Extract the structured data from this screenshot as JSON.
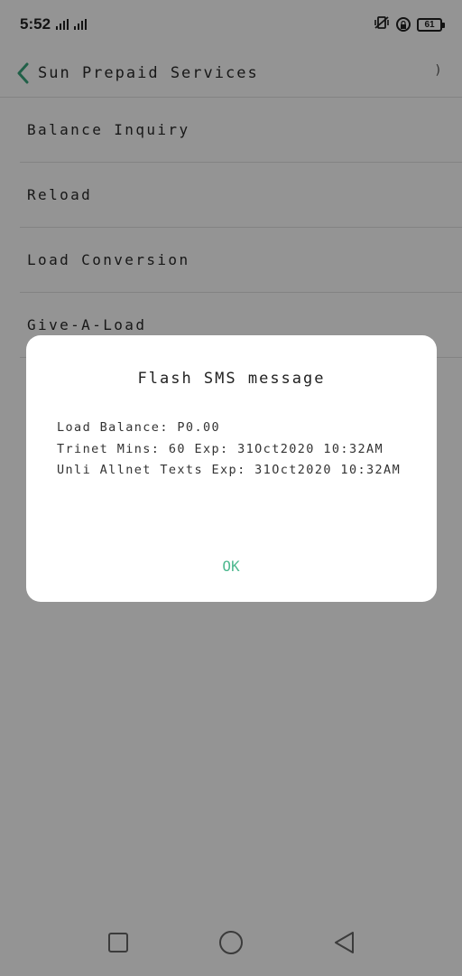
{
  "status_bar": {
    "time": "5:52",
    "battery": "61"
  },
  "app_bar": {
    "title": "Sun Prepaid Services",
    "right_glyph": ")"
  },
  "menu": {
    "items": [
      {
        "label": "Balance Inquiry"
      },
      {
        "label": "Reload"
      },
      {
        "label": "Load Conversion"
      },
      {
        "label": "Give-A-Load"
      }
    ]
  },
  "dialog": {
    "title": "Flash SMS message",
    "lines": [
      "Load Balance: P0.00",
      "Trinet Mins: 60 Exp: 31Oct2020 10:32AM",
      "Unli Allnet Texts Exp: 31Oct2020 10:32AM"
    ],
    "ok_label": "OK"
  },
  "colors": {
    "accent": "#4fb990",
    "overlay": "#000000"
  },
  "icons": {
    "back": "chevron-left-icon",
    "signal": "cellular-signal-icon",
    "mute": "vibrate-off-icon",
    "lock": "rotation-lock-icon",
    "battery": "battery-icon",
    "recents": "square-icon",
    "home": "circle-icon",
    "back_nav": "triangle-back-icon"
  }
}
